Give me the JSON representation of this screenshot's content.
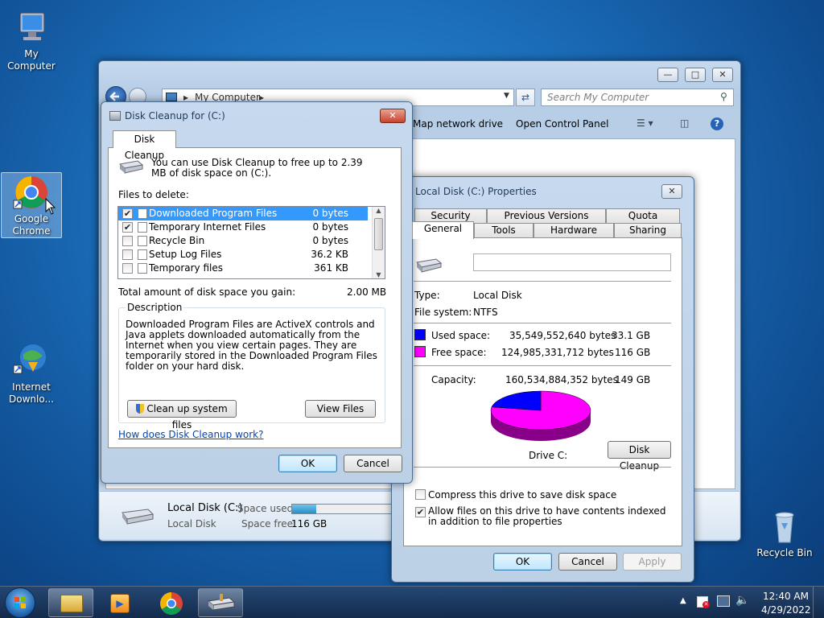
{
  "desktop": {
    "icons": [
      {
        "label": "My Computer"
      },
      {
        "label": "Google Chrome"
      },
      {
        "label": "Internet Downlo..."
      },
      {
        "label": "Recycle Bin"
      }
    ]
  },
  "explorer": {
    "breadcrumb": "My Computer",
    "search_placeholder": "Search My Computer",
    "toolbar": {
      "map_drive": "Map network drive",
      "control_panel": "Open Control Panel"
    },
    "status": {
      "name": "Local Disk (C:)",
      "type": "Local Disk",
      "space_used_label": "Space used:",
      "space_free_label": "Space free:",
      "space_free": "116 GB",
      "used_fraction": 0.22
    }
  },
  "disk_cleanup": {
    "title": "Disk Cleanup for  (C:)",
    "tab": "Disk Cleanup",
    "intro": "You can use Disk Cleanup to free up to 2.39 MB of disk space on  (C:).",
    "files_label": "Files to delete:",
    "files": [
      {
        "name": "Downloaded Program Files",
        "size": "0 bytes",
        "checked": true,
        "selected": true
      },
      {
        "name": "Temporary Internet Files",
        "size": "0 bytes",
        "checked": true,
        "selected": false
      },
      {
        "name": "Recycle Bin",
        "size": "0 bytes",
        "checked": false,
        "selected": false
      },
      {
        "name": "Setup Log Files",
        "size": "36.2 KB",
        "checked": false,
        "selected": false
      },
      {
        "name": "Temporary files",
        "size": "361 KB",
        "checked": false,
        "selected": false
      }
    ],
    "total_label": "Total amount of disk space you gain:",
    "total_value": "2.00 MB",
    "description_label": "Description",
    "description": "Downloaded Program Files are ActiveX controls and Java applets downloaded automatically from the Internet when you view certain pages. They are temporarily stored in the Downloaded Program Files folder on your hard disk.",
    "cleanup_system_button": "Clean up system files",
    "view_files_button": "View Files",
    "help_link": "How does Disk Cleanup work?",
    "ok": "OK",
    "cancel": "Cancel"
  },
  "properties": {
    "title": "Local Disk (C:) Properties",
    "tabs_back": [
      "Security",
      "Previous Versions",
      "Quota"
    ],
    "tabs_front": [
      "General",
      "Tools",
      "Hardware",
      "Sharing"
    ],
    "active_tab": "General",
    "name_value": "",
    "type_label": "Type:",
    "type_value": "Local Disk",
    "fs_label": "File system:",
    "fs_value": "NTFS",
    "used_label": "Used space:",
    "used_bytes": "35,549,552,640 bytes",
    "used_gb": "33.1 GB",
    "free_label": "Free space:",
    "free_bytes": "124,985,331,712 bytes",
    "free_gb": "116 GB",
    "capacity_label": "Capacity:",
    "capacity_bytes": "160,534,884,352 bytes",
    "capacity_gb": "149 GB",
    "used_color": "#0000ff",
    "free_color": "#ff00ff",
    "drive_label": "Drive C:",
    "disk_cleanup_button": "Disk Cleanup",
    "compress_label": "Compress this drive to save disk space",
    "compress_checked": false,
    "index_label": "Allow files on this drive to have contents indexed in addition to file properties",
    "index_checked": true,
    "ok": "OK",
    "cancel": "Cancel",
    "apply": "Apply"
  },
  "taskbar": {
    "time": "12:40 AM",
    "date": "4/29/2022"
  }
}
